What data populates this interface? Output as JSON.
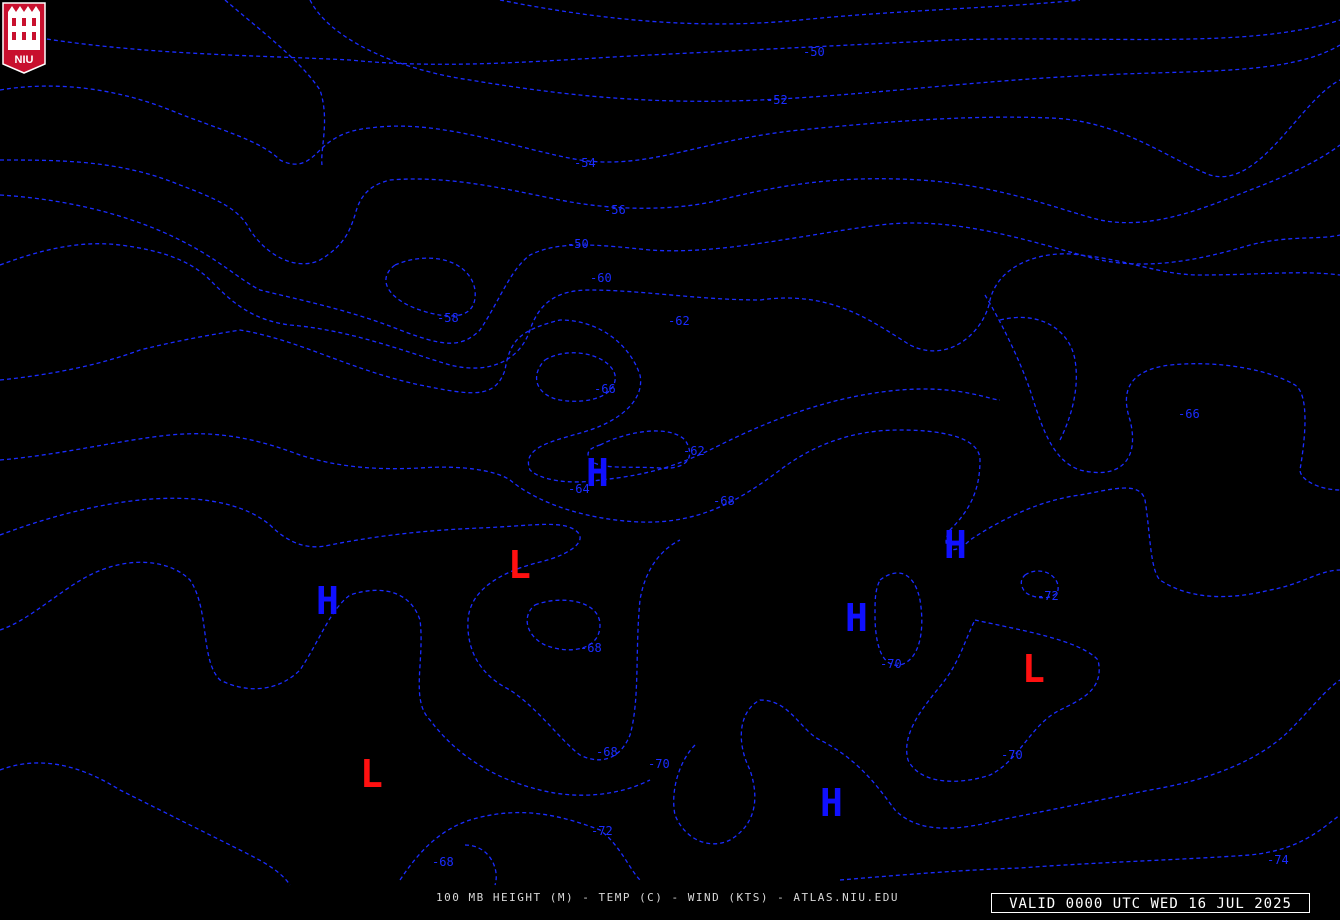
{
  "logo": {
    "text": "NIU",
    "colors": {
      "shield": "#c8102e",
      "tower": "#ffffff"
    }
  },
  "footer": {
    "caption": "100 MB HEIGHT (M) - TEMP (C) - WIND (KTS) - ATLAS.NIU.EDU",
    "valid": "VALID 0000 UTC WED 16 JUL 2025"
  },
  "colors": {
    "isotherm": "#1a2cff",
    "high": "#1010ff",
    "low": "#ff1010",
    "background": "#000000"
  },
  "isotherm_labels": [
    "-50",
    "-52",
    "-54",
    "-56",
    "-50",
    "-60",
    "-58",
    "-62",
    "-66",
    "-62",
    "-64",
    "-68",
    "-66",
    "-68",
    "-68",
    "-70",
    "-70",
    "-72",
    "-72",
    "-70",
    "-68",
    "-74",
    "-74"
  ],
  "pressure_centers": [
    "H",
    "L",
    "H",
    "H",
    "H",
    "L",
    "L",
    "H"
  ]
}
